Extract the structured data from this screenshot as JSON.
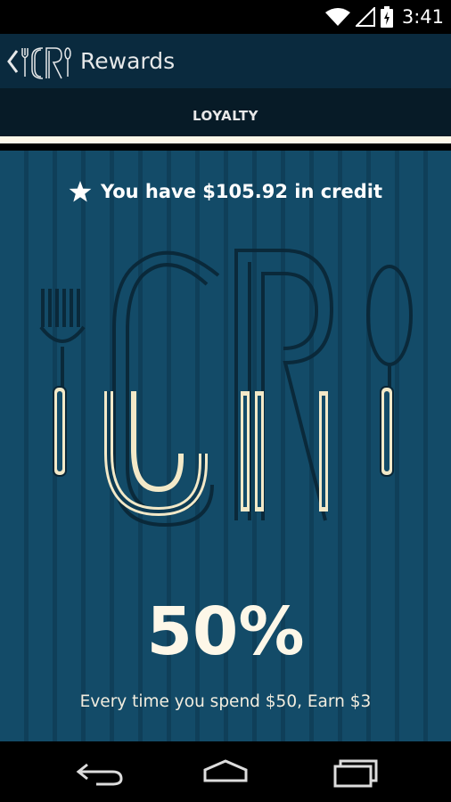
{
  "status_bar": {
    "time": "3:41",
    "icons": [
      "wifi-icon",
      "cell-signal-icon",
      "battery-icon"
    ]
  },
  "action_bar": {
    "back_icon": "chevron-left-icon",
    "logo_icon": "cr-fork-spoon-logo-icon",
    "title": "Rewards"
  },
  "tabs": [
    {
      "label": "LOYALTY",
      "selected": true
    }
  ],
  "rewards": {
    "star_icon": "star-icon",
    "credit_text": "You have $105.92 in credit",
    "percent": "50%",
    "description": "Every time you spend $50, Earn $3"
  },
  "nav_bar": {
    "buttons": [
      "back-nav-icon",
      "home-nav-icon",
      "recents-nav-icon"
    ]
  },
  "colors": {
    "action_bar": "#0a2a3e",
    "tab_bar": "#071b27",
    "content_bg": "#134b68",
    "stripe": "#0f3f59",
    "cream": "#fdf7e8"
  }
}
